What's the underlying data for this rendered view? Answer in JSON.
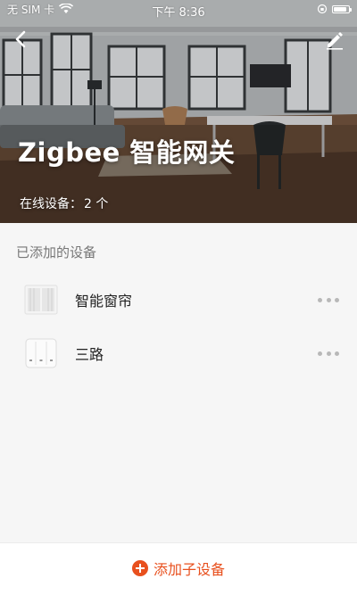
{
  "status_bar": {
    "carrier": "无 SIM 卡",
    "time": "下午 8:36",
    "battery_level": 0.85
  },
  "header": {
    "back_icon": "chevron-left-icon",
    "edit_icon": "pencil-icon",
    "title": "Zigbee 智能网关",
    "online_label": "在线设备：",
    "online_count": "2 个"
  },
  "section": {
    "label": "已添加的设备"
  },
  "devices": [
    {
      "name": "智能窗帘",
      "icon": "curtain-icon"
    },
    {
      "name": "三路",
      "icon": "three-gang-switch-icon"
    }
  ],
  "footer": {
    "add_label": "添加子设备",
    "add_icon": "plus-circle-icon"
  },
  "colors": {
    "accent": "#e8501e",
    "background": "#f6f6f6",
    "muted_text": "#777777"
  }
}
